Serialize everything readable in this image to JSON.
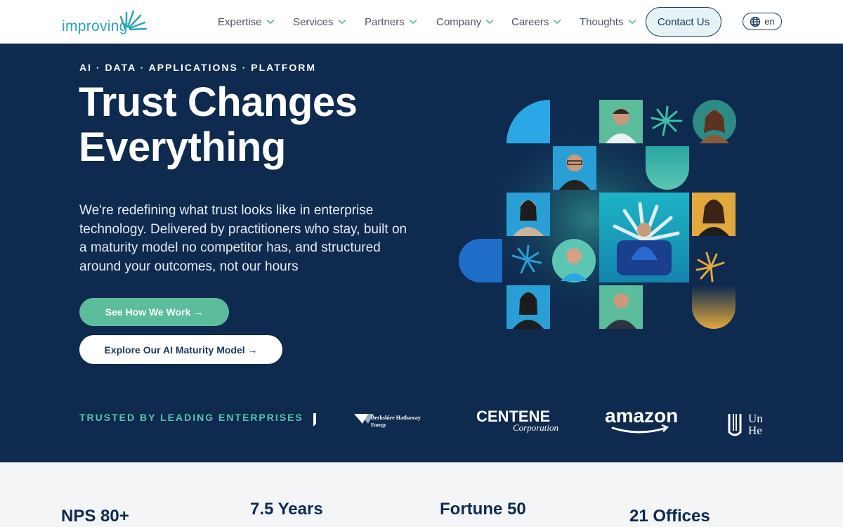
{
  "header": {
    "logo_text": "improving",
    "nav": [
      {
        "label": "Expertise"
      },
      {
        "label": "Services"
      },
      {
        "label": "Partners"
      },
      {
        "label": "Company"
      },
      {
        "label": "Careers"
      },
      {
        "label": "Thoughts"
      }
    ],
    "contact_label": "Contact Us",
    "lang_label": "en",
    "icons": {
      "chevron": "chevron-down-icon",
      "globe": "globe-icon"
    }
  },
  "hero": {
    "eyebrow": "AI · DATA · APPLICATIONS · PLATFORM",
    "title_line1": "Trust Changes",
    "title_line2": "Everything",
    "description": "We're redefining what trust looks like in enterprise technology. Delivered by practitioners who stay, built on a maturity model no competitor has, and structured around your outcomes, not our hours",
    "primary_cta": "See How We Work →",
    "secondary_cta": "Explore Our AI Maturity Model →",
    "trusted_label": "TRUSTED BY LEADING ENTERPRISES",
    "client_logos": [
      {
        "name": "Berkshire Hathaway",
        "line1": "Berkshire Hathaway",
        "line2": "Energy"
      },
      {
        "name": "Centene",
        "line1": "CENTENE",
        "line2": "Corporation"
      },
      {
        "name": "Amazon",
        "line1": "amazon"
      },
      {
        "name": "UnitedHealth",
        "line1": "Un",
        "line2": "He"
      }
    ]
  },
  "stats": [
    {
      "value": "NPS 80+"
    },
    {
      "value": "7.5 Years"
    },
    {
      "value": "Fortune 50"
    },
    {
      "value": "21 Offices"
    }
  ],
  "colors": {
    "navy": "#0e2a4f",
    "teal": "#27a5b8",
    "green": "#5bbd9b",
    "gold": "#e2a83e",
    "sky": "#2aa8e6"
  }
}
